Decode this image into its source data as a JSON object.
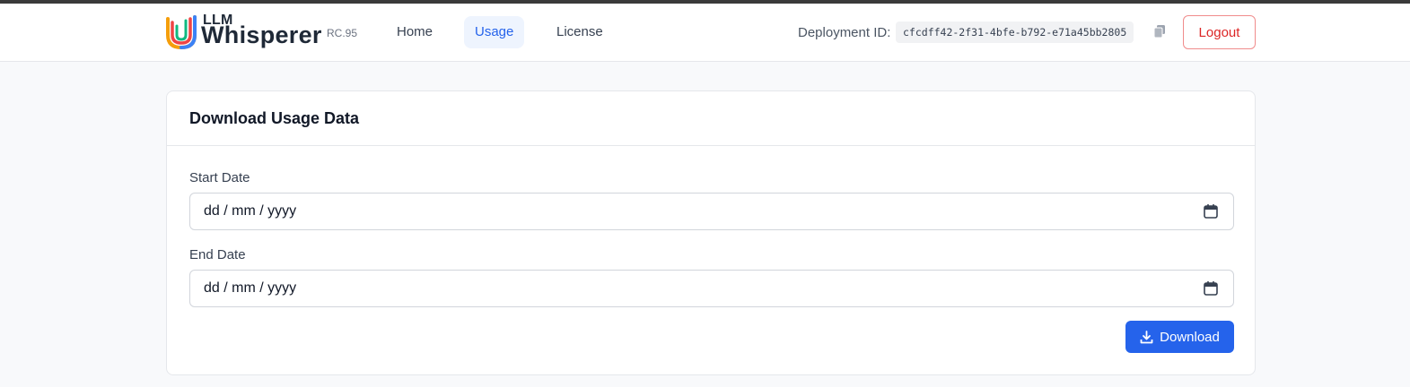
{
  "brand": {
    "top": "LLM",
    "name": "Whisperer",
    "version": "RC.95"
  },
  "nav": {
    "home": "Home",
    "usage": "Usage",
    "license": "License"
  },
  "deployment": {
    "label": "Deployment ID:",
    "id": "cfcdff42-2f31-4bfe-b792-e71a45bb2805"
  },
  "header": {
    "logout": "Logout"
  },
  "card": {
    "title": "Download Usage Data",
    "start_label": "Start Date",
    "start_value": "dd / mm / yyyy",
    "end_label": "End Date",
    "end_value": "dd / mm / yyyy",
    "download": "Download"
  },
  "colors": {
    "accent": "#2563eb",
    "danger": "#dc2626",
    "active_bg": "#eef4fe"
  },
  "icons": {
    "copy": "copy-icon",
    "calendar": "calendar-icon",
    "download": "download-icon"
  }
}
